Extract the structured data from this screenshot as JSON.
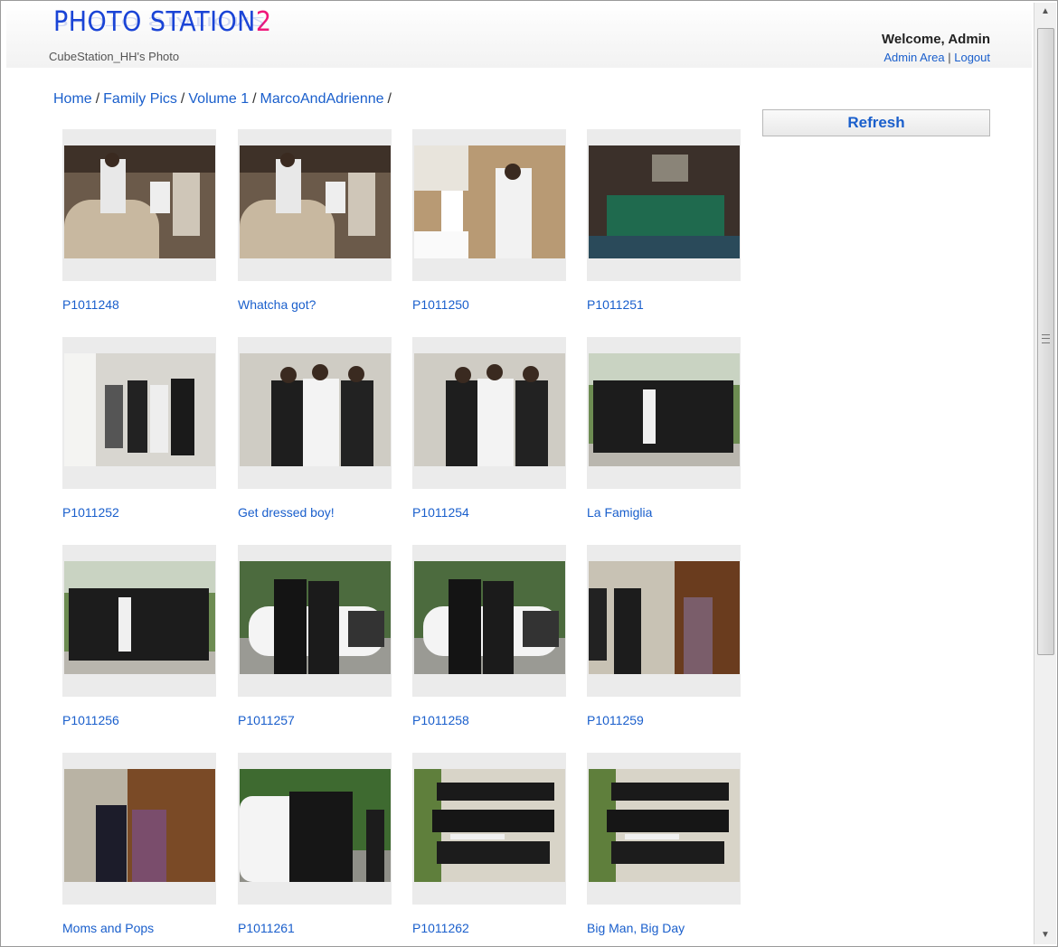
{
  "app": {
    "logo_text": "PHOTO STATION",
    "logo_suffix": "2",
    "subtitle": "CubeStation_HH's Photo"
  },
  "user": {
    "welcome": "Welcome, Admin",
    "admin_link": "Admin Area",
    "separator": "|",
    "logout_link": "Logout"
  },
  "breadcrumb": [
    {
      "label": "Home"
    },
    {
      "label": "Family Pics"
    },
    {
      "label": "Volume 1"
    },
    {
      "label": "MarcoAndAdrienne"
    }
  ],
  "breadcrumb_separator": "/",
  "refresh_label": "Refresh",
  "photos": [
    {
      "caption": "P1011248",
      "scene": "waiters-table"
    },
    {
      "caption": "Whatcha got?",
      "scene": "waiters-table"
    },
    {
      "caption": "P1011250",
      "scene": "busy-room"
    },
    {
      "caption": "P1011251",
      "scene": "dark-room-table"
    },
    {
      "caption": "P1011252",
      "scene": "men-in-room"
    },
    {
      "caption": "Get dressed boy!",
      "scene": "men-dressing"
    },
    {
      "caption": "P1011254",
      "scene": "men-dressing"
    },
    {
      "caption": "La Famiglia",
      "scene": "group-outdoors"
    },
    {
      "caption": "P1011256",
      "scene": "group-outdoors"
    },
    {
      "caption": "P1011257",
      "scene": "limo-pair"
    },
    {
      "caption": "P1011258",
      "scene": "limo-pair"
    },
    {
      "caption": "P1011259",
      "scene": "doorway"
    },
    {
      "caption": "Moms and Pops",
      "scene": "couple-door"
    },
    {
      "caption": "P1011261",
      "scene": "limo-group"
    },
    {
      "caption": "P1011262",
      "scene": "rotated-group"
    },
    {
      "caption": "Big Man, Big Day",
      "scene": "rotated-group"
    }
  ]
}
